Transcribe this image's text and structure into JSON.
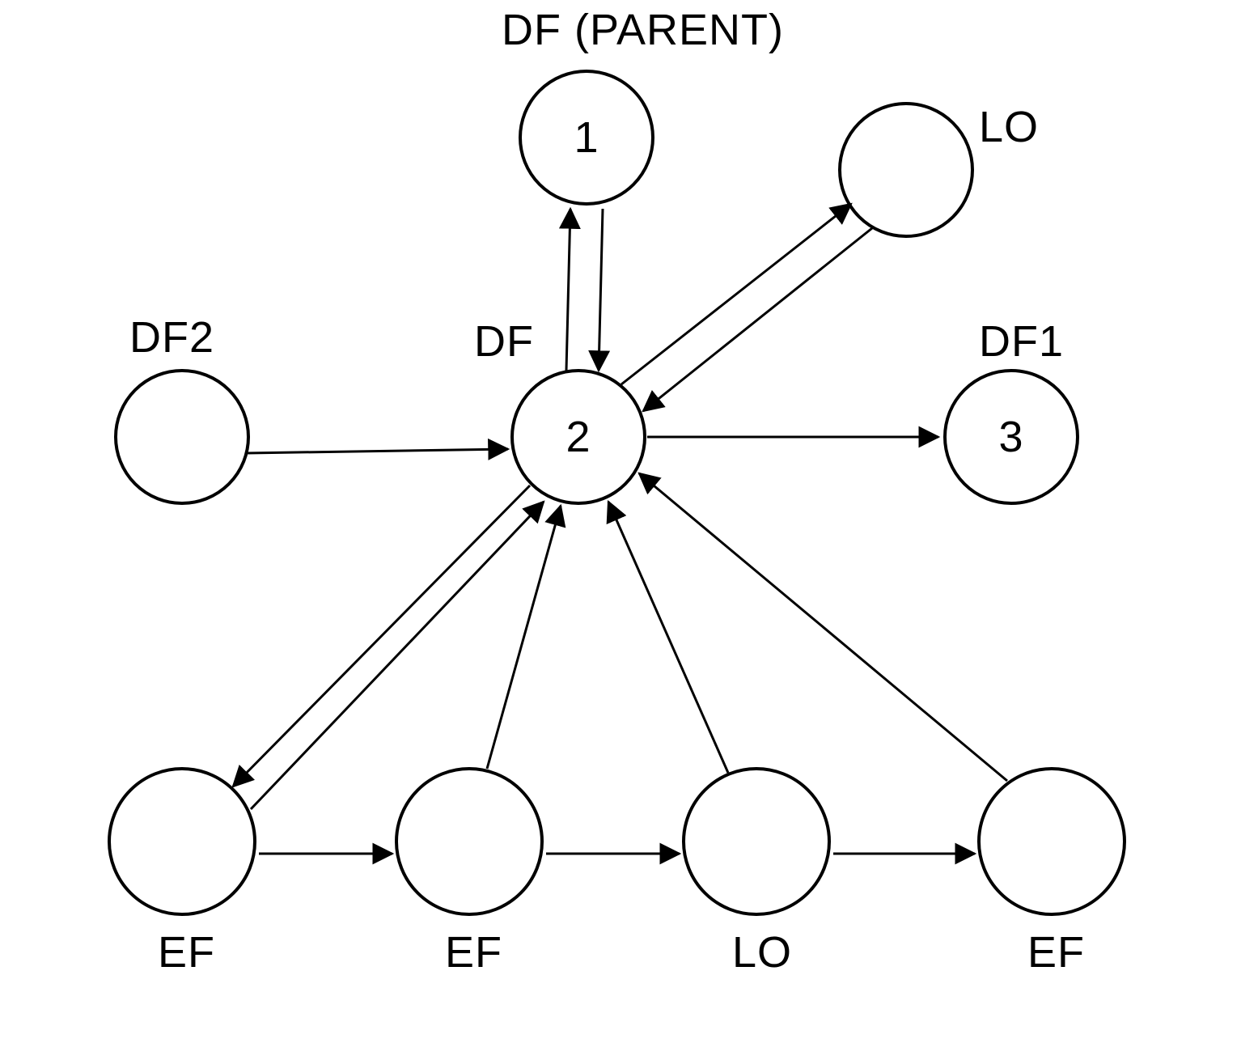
{
  "nodes": {
    "n1": {
      "label": "DF (PARENT)",
      "id": "1"
    },
    "n2": {
      "label": "DF",
      "id": "2"
    },
    "n3": {
      "label": "DF1",
      "id": "3"
    },
    "nLOtop": {
      "label": "LO"
    },
    "nDF2": {
      "label": "DF2"
    },
    "nEF_bl": {
      "label": "EF"
    },
    "nEF_b2": {
      "label": "EF"
    },
    "nLO_b": {
      "label": "LO"
    },
    "nEF_br": {
      "label": "EF"
    }
  }
}
